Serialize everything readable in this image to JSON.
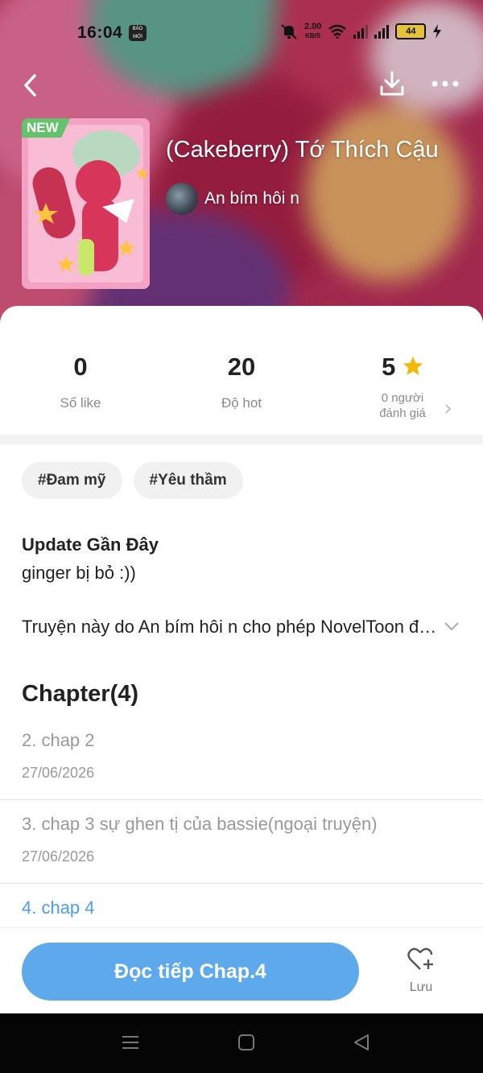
{
  "status_bar": {
    "time": "16:04",
    "badge_text": "BÁO MỚI",
    "speed_value": "2.00",
    "speed_unit": "KB/S",
    "battery": "44"
  },
  "book": {
    "new_tag": "NEW",
    "title": "(Cakeberry) Tớ Thích Cậu",
    "author": "An bím hôi n"
  },
  "stats": {
    "likes_value": "0",
    "likes_label": "Số like",
    "hot_value": "20",
    "hot_label": "Độ hot",
    "rating_value": "5",
    "rating_label_line1": "0 người",
    "rating_label_line2": "đánh giá"
  },
  "tags": [
    "#Đam mỹ",
    "#Yêu thầm"
  ],
  "update": {
    "title": "Update Gần Đây",
    "text": "ginger bị bỏ :))"
  },
  "description": "Truyện này do An bím hôi n cho phép NovelToon độc quyền đăng tải",
  "chapters": {
    "header": "Chapter(4)",
    "items": [
      {
        "name": "2. chap 2",
        "date": "27/06/2026"
      },
      {
        "name": "3. chap 3 sự ghen tị của bassie(ngoại truyện)",
        "date": "27/06/2026"
      },
      {
        "name": "4. chap 4",
        "date": ""
      }
    ]
  },
  "actions": {
    "read_label": "Đọc tiếp Chap.4",
    "save_label": "Lưu"
  },
  "colors": {
    "accent": "#5da9ec",
    "active_chapter": "#4d9ee8",
    "star": "#f5b800",
    "new_tag": "#62c36a"
  },
  "icons": [
    "back-arrow-icon",
    "download-icon",
    "more-icon",
    "star-icon",
    "chevron-right-icon",
    "chevron-down-icon",
    "heart-plus-icon",
    "menu-icon",
    "home-square-icon",
    "back-triangle-icon"
  ]
}
